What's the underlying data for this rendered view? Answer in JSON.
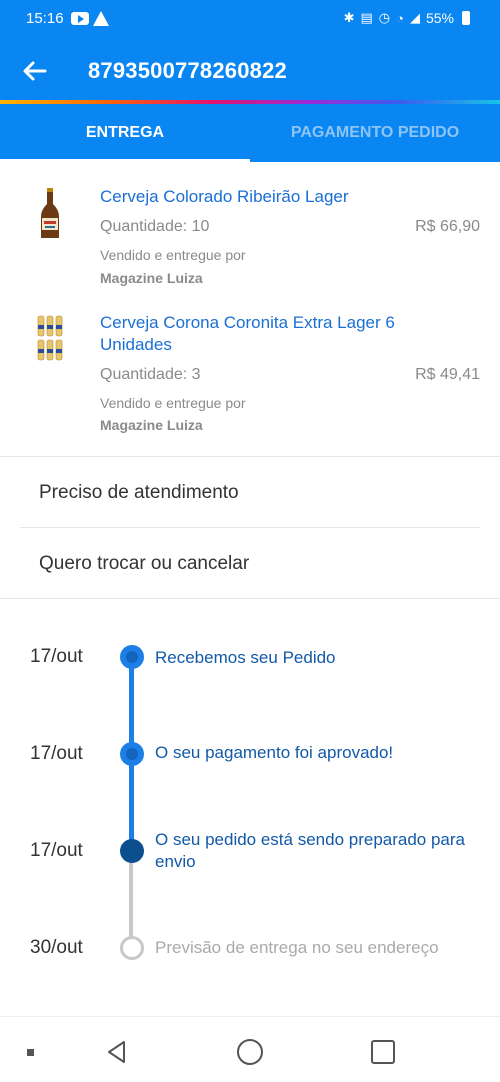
{
  "status_bar": {
    "time": "15:16",
    "battery": "55%",
    "icons": [
      "youtube-icon",
      "alert-icon",
      "bluetooth-icon",
      "volte-icon",
      "alarm-icon",
      "wifi-icon",
      "signal-icon",
      "battery-icon"
    ]
  },
  "header": {
    "order_number": "8793500778260822",
    "back_icon": "arrow-left-icon",
    "background": "#0a86f3"
  },
  "tabs": [
    {
      "label": "ENTREGA",
      "active": true
    },
    {
      "label": "PAGAMENTO PEDIDO",
      "active": false
    }
  ],
  "products": [
    {
      "name": "Cerveja Colorado Ribeirão Lager",
      "quantity": "Quantidade: 10",
      "price": "R$ 66,90",
      "seller_label": "Vendido e entregue por",
      "seller": "Magazine Luiza",
      "thumb_icon": "beer-bottle-icon"
    },
    {
      "name": "Cerveja Corona Coronita Extra Lager 6 Unidades",
      "quantity": "Quantidade: 3",
      "price": "R$ 49,41",
      "seller_label": "Vendido e entregue por",
      "seller": "Magazine Luiza",
      "thumb_icon": "beer-six-pack-icon"
    }
  ],
  "actions": [
    {
      "label": "Preciso de atendimento"
    },
    {
      "label": "Quero trocar ou cancelar"
    }
  ],
  "timeline": [
    {
      "date": "17/out",
      "text": "Recebemos seu Pedido",
      "status": "done"
    },
    {
      "date": "17/out",
      "text": "O seu pagamento foi aprovado!",
      "status": "done"
    },
    {
      "date": "17/out",
      "text": "O seu pedido está sendo preparado para envio",
      "status": "current"
    },
    {
      "date": "30/out",
      "text": "Previsão de entrega no seu endereço",
      "status": "pending"
    }
  ],
  "colors": {
    "primary": "#0a86f3",
    "link": "#1a6fd6",
    "timeline_blue": "#1c7fe5",
    "timeline_gray": "#c8c8c8"
  }
}
